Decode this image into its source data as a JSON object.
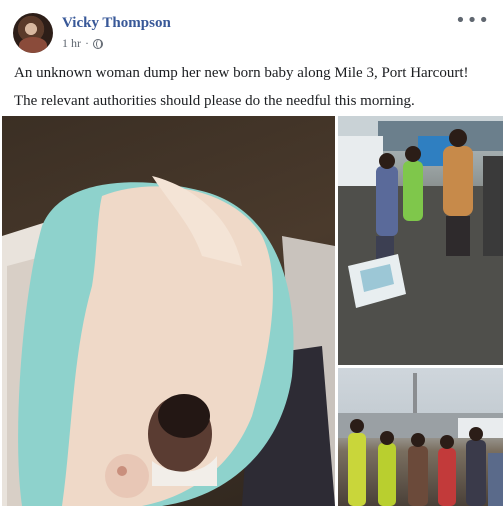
{
  "post": {
    "author": "Vicky Thompson",
    "time": "1 hr",
    "separator": "·",
    "more_label": "•••",
    "paragraphs": [
      "An unknown woman dump her new born baby along Mile 3, Port Harcourt!",
      "The relevant authorities should please do the needful this morning."
    ]
  },
  "icons": {
    "avatar": "profile-photo",
    "privacy": "globe-icon",
    "more": "more-options-icon"
  },
  "photos": [
    {
      "name": "newborn-baby-in-blanket-photo"
    },
    {
      "name": "street-crowd-with-bag-photo"
    },
    {
      "name": "crowd-on-road-photo"
    }
  ],
  "colors": {
    "author_name": "#385898",
    "meta_text": "#606770",
    "body_text": "#1c1e21"
  }
}
